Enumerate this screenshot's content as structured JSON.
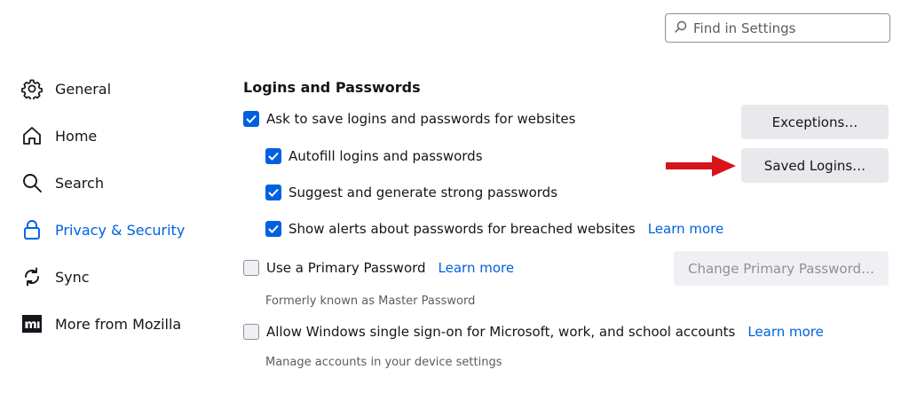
{
  "search": {
    "placeholder": "Find in Settings",
    "icon": "search-icon"
  },
  "sidebar": {
    "items": [
      {
        "label": "General",
        "icon": "gear-icon",
        "active": false
      },
      {
        "label": "Home",
        "icon": "home-icon",
        "active": false
      },
      {
        "label": "Search",
        "icon": "search-icon",
        "active": false
      },
      {
        "label": "Privacy & Security",
        "icon": "lock-icon",
        "active": true
      },
      {
        "label": "Sync",
        "icon": "sync-icon",
        "active": false
      },
      {
        "label": "More from Mozilla",
        "icon": "mozilla-logo-icon",
        "active": false
      }
    ]
  },
  "section": {
    "title": "Logins and Passwords",
    "ask_save": {
      "label": "Ask to save logins and passwords for websites",
      "checked": true
    },
    "autofill": {
      "label": "Autofill logins and passwords",
      "checked": true
    },
    "suggest": {
      "label": "Suggest and generate strong passwords",
      "checked": true
    },
    "breach_alerts": {
      "label": "Show alerts about passwords for breached websites",
      "checked": true,
      "link": "Learn more"
    },
    "primary_password": {
      "label": "Use a Primary Password",
      "checked": false,
      "link": "Learn more",
      "note": "Formerly known as Master Password"
    },
    "windows_sso": {
      "label": "Allow Windows single sign-on for Microsoft, work, and school accounts",
      "checked": false,
      "link": "Learn more",
      "note": "Manage accounts in your device settings"
    }
  },
  "buttons": {
    "exceptions": "Exceptions…",
    "saved_logins": "Saved Logins…",
    "change_primary_password": "Change Primary Password…"
  },
  "annotation": {
    "arrow_color": "#d7141a"
  },
  "colors": {
    "accent": "#0061e0",
    "text": "#15141a",
    "muted": "#5b5b66"
  }
}
